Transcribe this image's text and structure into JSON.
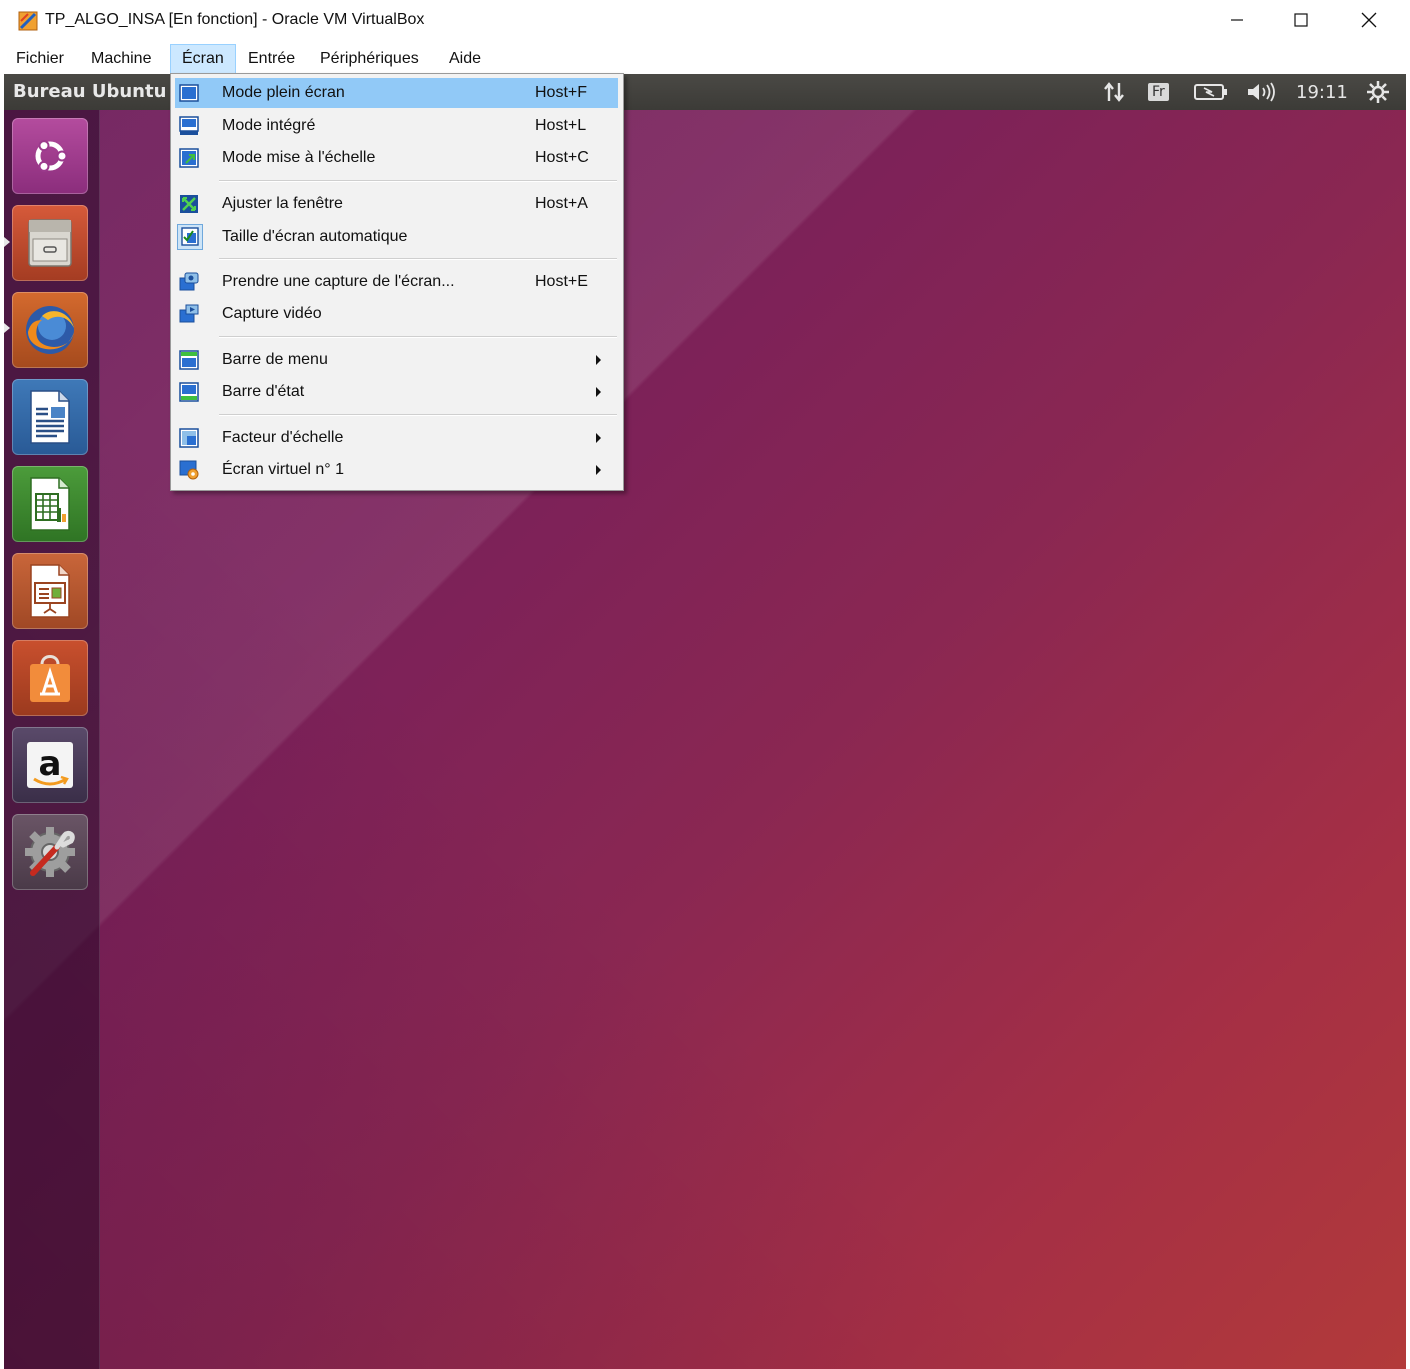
{
  "window": {
    "title": "TP_ALGO_INSA [En fonction] - Oracle VM VirtualBox",
    "app_icon": "virtualbox-icon",
    "controls": [
      "minimize-icon",
      "maximize-icon",
      "close-icon"
    ]
  },
  "menubar": {
    "items": [
      {
        "label": "Fichier"
      },
      {
        "label": "Machine"
      },
      {
        "label": "Écran",
        "open": true
      },
      {
        "label": "Entrée"
      },
      {
        "label": "Périphériques"
      },
      {
        "label": "Aide"
      }
    ]
  },
  "ecran_menu": {
    "items": [
      {
        "label": "Mode plein écran",
        "shortcut": "Host+F",
        "icon": "fullscreen-mode-icon",
        "highlighted": true
      },
      {
        "label": "Mode intégré",
        "shortcut": "Host+L",
        "icon": "seamless-mode-icon"
      },
      {
        "label": "Mode mise à l'échelle",
        "shortcut": "Host+C",
        "icon": "scale-mode-icon"
      },
      {
        "label": "Ajuster la fenêtre",
        "shortcut": "Host+A",
        "icon": "adjust-window-icon"
      },
      {
        "label": "Taille d'écran automatique",
        "shortcut": "",
        "icon": "auto-resize-icon",
        "checked": true
      },
      {
        "label": "Prendre une capture de l'écran...",
        "shortcut": "Host+E",
        "icon": "screenshot-icon"
      },
      {
        "label": "Capture vidéo",
        "shortcut": "",
        "icon": "video-capture-icon"
      },
      {
        "label": "Barre de menu",
        "shortcut": "",
        "icon": "menu-bar-icon",
        "submenu": true
      },
      {
        "label": "Barre d'état",
        "shortcut": "",
        "icon": "status-bar-icon",
        "submenu": true
      },
      {
        "label": "Facteur d'échelle",
        "shortcut": "",
        "icon": "scale-factor-icon",
        "submenu": true
      },
      {
        "label": "Écran virtuel n° 1",
        "shortcut": "",
        "icon": "virtual-screen-icon",
        "submenu": true
      }
    ]
  },
  "ubuntu": {
    "panel_title": "Bureau Ubuntu",
    "keyboard_layout": "Fr",
    "clock": "19:11",
    "tray_icons": [
      "network-icon",
      "keyboard-layout-icon",
      "battery-icon",
      "volume-icon",
      "session-gear-icon"
    ],
    "launcher": [
      {
        "name": "ubuntu-dash-icon"
      },
      {
        "name": "files-icon",
        "running": true
      },
      {
        "name": "firefox-icon",
        "running": true
      },
      {
        "name": "libreoffice-writer-icon"
      },
      {
        "name": "libreoffice-calc-icon"
      },
      {
        "name": "libreoffice-impress-icon"
      },
      {
        "name": "ubuntu-software-icon"
      },
      {
        "name": "amazon-icon"
      },
      {
        "name": "system-settings-icon"
      }
    ]
  },
  "colors": {
    "menu_highlight": "#91c9f7",
    "menubar_open": "#cce8ff",
    "wallpaper_start": "#6e1e5c",
    "wallpaper_end": "#b23a3a",
    "panel": "#3c3b37"
  }
}
